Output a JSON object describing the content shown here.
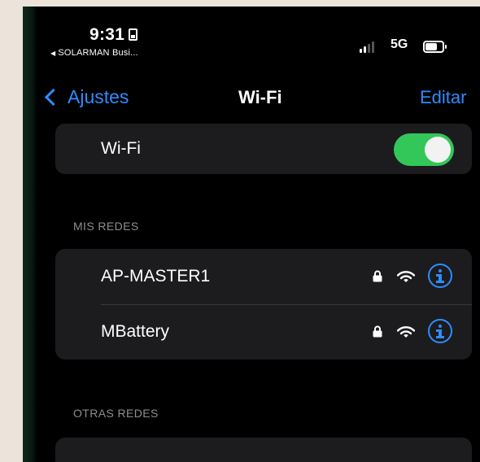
{
  "status_bar": {
    "time": "9:31",
    "back_app": "SOLARMAN Busi...",
    "network_type": "5G"
  },
  "nav": {
    "back_label": "Ajustes",
    "title": "Wi-Fi",
    "edit_label": "Editar"
  },
  "wifi_toggle": {
    "label": "Wi-Fi",
    "enabled": true,
    "accent_color": "#33c759"
  },
  "my_networks": {
    "header": "MIS REDES",
    "items": [
      {
        "name": "AP-MASTER1",
        "secured": true,
        "icons": [
          "lock-icon",
          "wifi-signal-icon",
          "info-icon"
        ]
      },
      {
        "name": "MBattery",
        "secured": true,
        "icons": [
          "lock-icon",
          "wifi-signal-icon",
          "info-icon"
        ]
      }
    ]
  },
  "other_networks": {
    "header": "OTRAS REDES"
  },
  "colors": {
    "link_blue": "#2f8cff",
    "background": "#000000",
    "group_bg": "#1c1c1e"
  }
}
